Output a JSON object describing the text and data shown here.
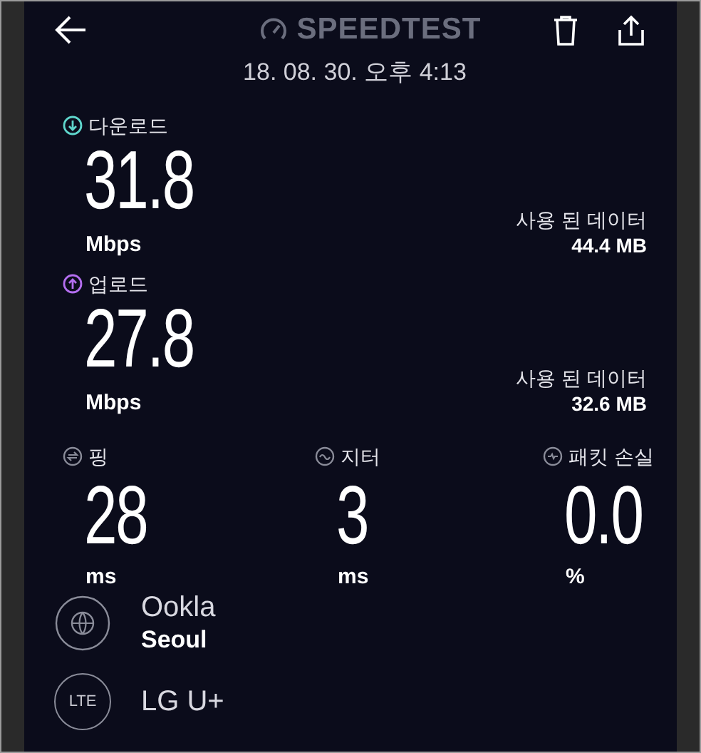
{
  "header": {
    "title": "SPEEDTEST",
    "date": "18. 08. 30. 오후 4:13"
  },
  "results": [
    {
      "kind": "download",
      "label": "다운로드",
      "value": "31.8",
      "unit": "Mbps",
      "data_label": "사용 된 데이터",
      "data_value": "44.4 MB"
    },
    {
      "kind": "upload",
      "label": "업로드",
      "value": "27.8",
      "unit": "Mbps",
      "data_label": "사용 된 데이터",
      "data_value": "32.6 MB"
    }
  ],
  "metrics": [
    {
      "kind": "ping",
      "label": "핑",
      "value": "28",
      "unit": "ms"
    },
    {
      "kind": "jitter",
      "label": "지터",
      "value": "3",
      "unit": "ms"
    },
    {
      "kind": "packet_loss",
      "label": "패킷 손실",
      "value": "0.0",
      "unit": "%"
    }
  ],
  "server": {
    "provider": "Ookla",
    "location": "Seoul"
  },
  "network": {
    "badge": "LTE",
    "carrier": "LG U+"
  }
}
